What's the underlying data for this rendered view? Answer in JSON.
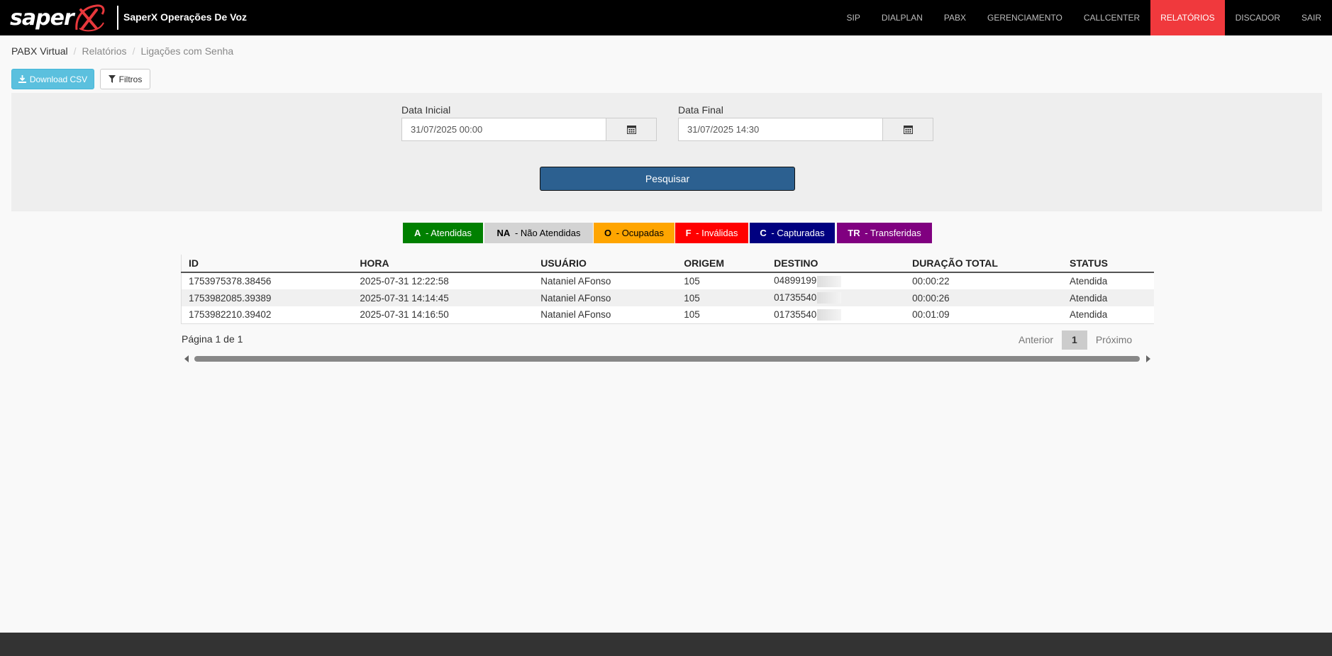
{
  "brand": {
    "logo_text": "saper",
    "title": "SaperX Operações De Voz"
  },
  "nav": [
    {
      "label": "SIP"
    },
    {
      "label": "DIALPLAN"
    },
    {
      "label": "PABX"
    },
    {
      "label": "GERENCIAMENTO"
    },
    {
      "label": "CALLCENTER"
    },
    {
      "label": "RELATÓRIOS",
      "active": true
    },
    {
      "label": "DISCADOR"
    },
    {
      "label": "SAIR"
    }
  ],
  "breadcrumb": [
    "PABX Virtual",
    "Relatórios",
    "Ligações com Senha"
  ],
  "toolbar": {
    "csv_label": "Download CSV",
    "filter_label": "Filtros"
  },
  "filters": {
    "start_label": "Data Inicial",
    "start_value": "31/07/2025 00:00",
    "end_label": "Data Final",
    "end_value": "31/07/2025 14:30",
    "search_label": "Pesquisar"
  },
  "legend": [
    {
      "code": "A",
      "text": " - Atendidas",
      "bg": "#008000",
      "fg": "#ffffff"
    },
    {
      "code": "NA",
      "text": " - Não Atendidas",
      "bg": "#d3d3d3",
      "fg": "#000000"
    },
    {
      "code": "O",
      "text": " - Ocupadas",
      "bg": "#ffa500",
      "fg": "#000000"
    },
    {
      "code": "F",
      "text": " - Inválidas",
      "bg": "#ff0000",
      "fg": "#ffffff"
    },
    {
      "code": "C",
      "text": " - Capturadas",
      "bg": "#000080",
      "fg": "#ffffff"
    },
    {
      "code": "TR",
      "text": " - Transferidas",
      "bg": "#800080",
      "fg": "#ffffff"
    }
  ],
  "table": {
    "columns": [
      "ID",
      "HORA",
      "USUÁRIO",
      "ORIGEM",
      "DESTINO",
      "DURAÇÃO TOTAL",
      "STATUS"
    ],
    "rows": [
      [
        "1753975378.38456",
        "2025-07-31 12:22:58",
        "Nataniel AFonso",
        "105",
        "04899199",
        "00:00:22",
        "Atendida"
      ],
      [
        "1753982085.39389",
        "2025-07-31 14:14:45",
        "Nataniel AFonso",
        "105",
        "01735540",
        "00:00:26",
        "Atendida"
      ],
      [
        "1753982210.39402",
        "2025-07-31 14:16:50",
        "Nataniel AFonso",
        "105",
        "01735540",
        "00:01:09",
        "Atendida"
      ]
    ]
  },
  "pagination": {
    "info": "Página 1 de 1",
    "prev": "Anterior",
    "current": "1",
    "next": "Próximo"
  }
}
